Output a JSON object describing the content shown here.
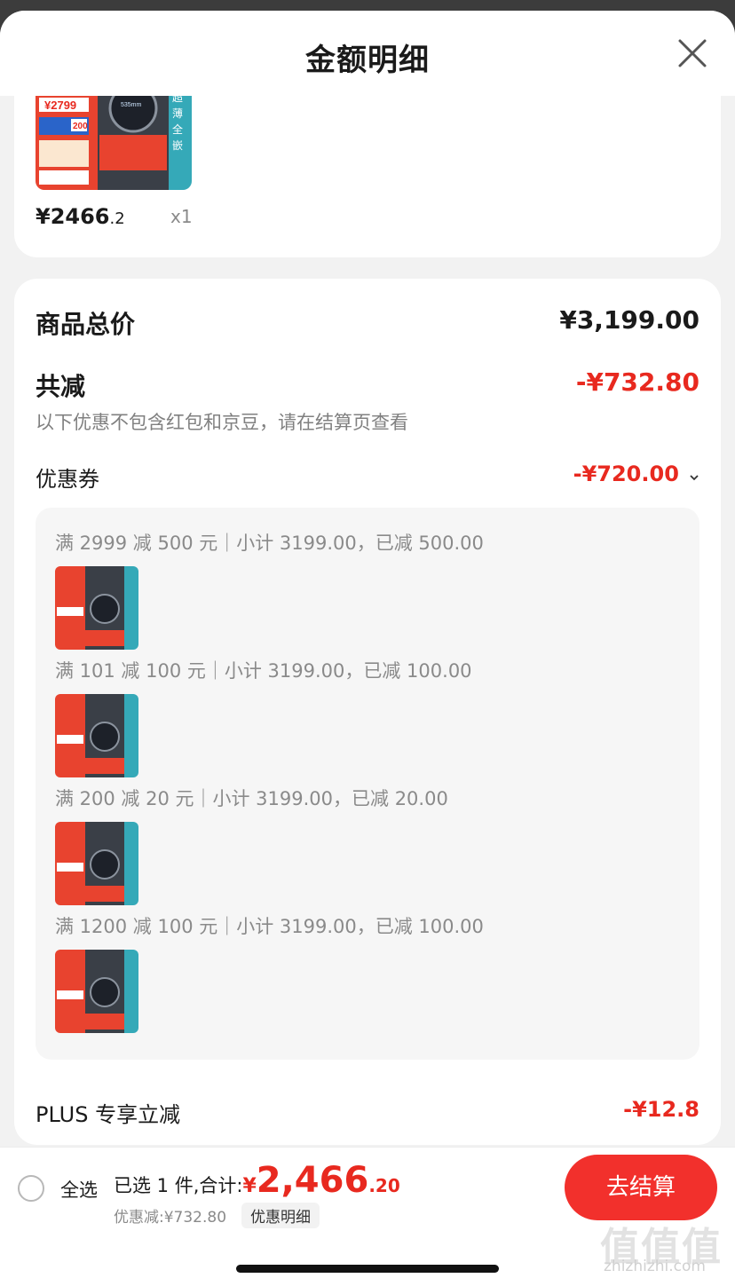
{
  "header": {
    "title": "金额明细",
    "close_icon": "close-icon"
  },
  "product": {
    "thumbnail_icon": "washing-machine-product-image",
    "price_main": "¥2466",
    "price_decimal": ".2",
    "quantity": "x1"
  },
  "summary": {
    "total_label": "商品总价",
    "total_value": "¥3,199.00",
    "reduced_label": "共减",
    "reduced_value": "-¥732.80",
    "note": "以下优惠不包含红包和京豆，请在结算页查看"
  },
  "coupon": {
    "label": "优惠券",
    "value": "-¥720.00",
    "items": [
      {
        "text": "满 2999 减 500 元｜小计 3199.00，已减 500.00"
      },
      {
        "text": "满 101 减 100 元｜小计 3199.00，已减 100.00"
      },
      {
        "text": "满 200 减 20 元｜小计 3199.00，已减 20.00"
      },
      {
        "text": "满 1200 减 100 元｜小计 3199.00，已减 100.00"
      }
    ]
  },
  "plus": {
    "label": "PLUS 专享立减",
    "value": "-¥12.8"
  },
  "bottom_bar": {
    "select_all_label": "全选",
    "selected_text": "已选 1 件,合计:",
    "total_yen": "¥",
    "total_int": "2,466",
    "total_dec": ".20",
    "discount_text": "优惠减:¥732.80",
    "detail_chip": "优惠明细",
    "checkout_label": "去结算"
  },
  "watermark": {
    "mark": "值值值",
    "url": "zhizhizhi.com"
  },
  "colors": {
    "accent_red": "#e8291f",
    "button_red": "#f2302c"
  }
}
